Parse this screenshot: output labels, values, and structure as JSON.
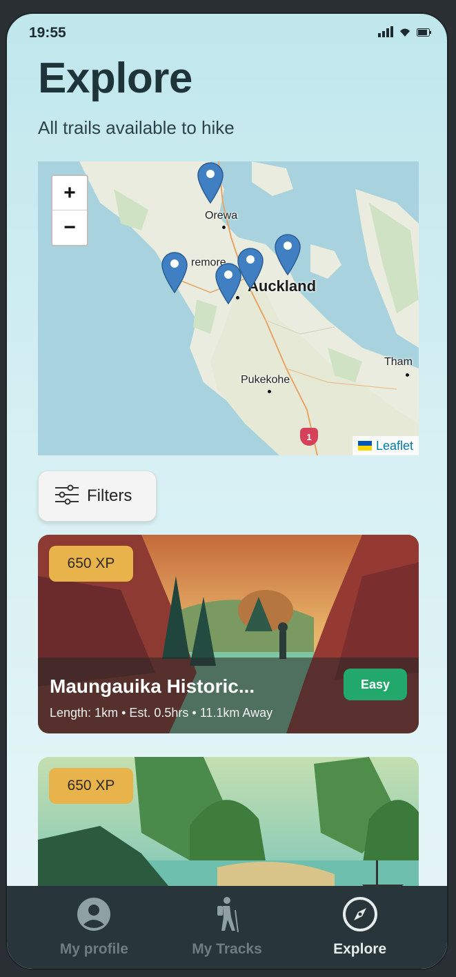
{
  "status_bar": {
    "time": "19:55"
  },
  "header": {
    "title": "Explore",
    "subtitle": "All trails available to hike"
  },
  "map": {
    "zoom_in": "+",
    "zoom_out": "−",
    "places": {
      "orewa": "Orewa",
      "whenuapai": "remore",
      "auckland": "Auckland",
      "pukekohe": "Pukekohe",
      "thames": "Tham",
      "route": "1"
    },
    "attribution": "Leaflet",
    "marker_color": "#3f7fc2"
  },
  "filters": {
    "label": "Filters",
    "icon": "sliders-icon"
  },
  "trails": [
    {
      "xp": "650 XP",
      "title": "Maungauika Historic...",
      "meta": "Length: 1km • Est. 0.5hrs • 11.1km Away",
      "difficulty": "Easy"
    },
    {
      "xp": "650 XP"
    }
  ],
  "tabbar": {
    "items": [
      {
        "label": "My profile",
        "icon": "profile-icon"
      },
      {
        "label": "My Tracks",
        "icon": "hiker-icon"
      },
      {
        "label": "Explore",
        "icon": "compass-icon",
        "active": true
      }
    ]
  },
  "colors": {
    "accent_badge": "#e8b34a",
    "easy_badge": "#22a86b",
    "tabbar_bg": "#28353a"
  }
}
